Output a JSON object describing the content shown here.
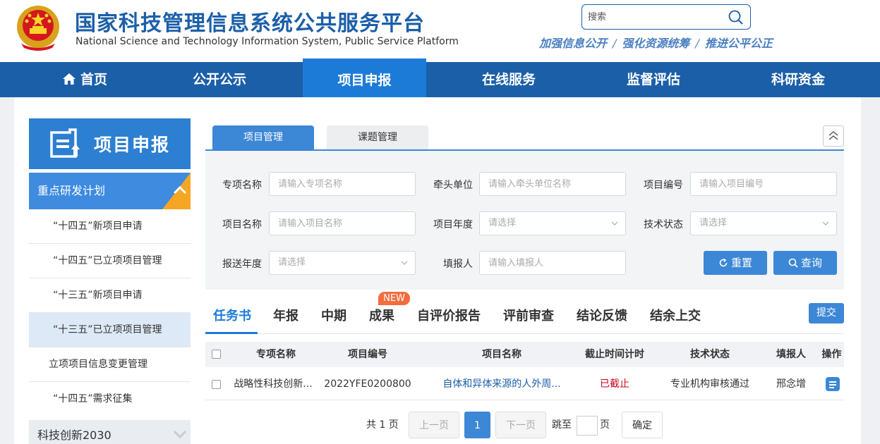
{
  "header": {
    "title": "国家科技管理信息系统公共服务平台",
    "subtitle": "National Science and Technology Information System, Public Service Platform",
    "search_placeholder": "搜索",
    "slogan": [
      "加强信息公开",
      "强化资源统筹",
      "推进公平公正"
    ],
    "slogan_sep": "/"
  },
  "nav": {
    "items": [
      {
        "label": "首页"
      },
      {
        "label": "公开公示"
      },
      {
        "label": "项目申报"
      },
      {
        "label": "在线服务"
      },
      {
        "label": "监督评估"
      },
      {
        "label": "科研资金"
      }
    ],
    "active": "项目申报"
  },
  "sidebar": {
    "title": "项目申报",
    "group": "重点研发计划",
    "items": [
      {
        "label": "“十四五”新项目申请"
      },
      {
        "label": "“十四五”已立项项目管理"
      },
      {
        "label": "“十三五”新项目申请"
      },
      {
        "label": "“十三五”已立项项目管理"
      },
      {
        "label": "立项项目信息变更管理"
      },
      {
        "label": "“十四五”需求征集"
      }
    ],
    "selected": "“十三五”已立项项目管理",
    "group2": "科技创新2030"
  },
  "tabs": {
    "items": [
      {
        "label": "项目管理"
      },
      {
        "label": "课题管理"
      }
    ],
    "active": "项目管理"
  },
  "filter": {
    "fields": [
      {
        "label": "专项名称",
        "placeholder": "请输入专项名称"
      },
      {
        "label": "牵头单位",
        "placeholder": "请输入牵头单位名称"
      },
      {
        "label": "项目编号",
        "placeholder": "请输入项目编号"
      },
      {
        "label": "项目名称",
        "placeholder": "请输入项目名称"
      },
      {
        "label": "项目年度",
        "placeholder": "请选择"
      },
      {
        "label": "技术状态",
        "placeholder": "请选择"
      },
      {
        "label": "报送年度",
        "placeholder": "请选择"
      },
      {
        "label": "填报人",
        "placeholder": "请输入填报人"
      }
    ],
    "reset_label": "重置",
    "query_label": "查询"
  },
  "subtabs": {
    "items": [
      {
        "label": "任务书"
      },
      {
        "label": "年报"
      },
      {
        "label": "中期"
      },
      {
        "label": "成果"
      },
      {
        "label": "自评价报告"
      },
      {
        "label": "评前审查"
      },
      {
        "label": "结论反馈"
      },
      {
        "label": "结余上交"
      }
    ],
    "active": "任务书",
    "new_badge": "NEW",
    "submit_label": "提交"
  },
  "table": {
    "columns": [
      "专项名称",
      "项目编号",
      "项目名称",
      "截止时间计时",
      "技术状态",
      "填报人",
      "操作"
    ],
    "rows": [
      {
        "special": "战略性科技创新...",
        "code": "2022YFE0200800",
        "name": "自体和异体来源的人外周...",
        "deadline": "已截止",
        "status": "专业机构审核通过",
        "reporter": "邢念增"
      }
    ]
  },
  "pagination": {
    "total": "共 1 页",
    "prev": "上一页",
    "current": "1",
    "next": "下一页",
    "goto": "跳至",
    "page_unit": "页",
    "confirm": "确定"
  },
  "colors": {
    "primary": "#1b5fa8",
    "nav_active": "#1d7bd8",
    "accent_orange": "#f5a623",
    "new_badge": "#f26d3d",
    "deadline_red": "#d0021b"
  }
}
